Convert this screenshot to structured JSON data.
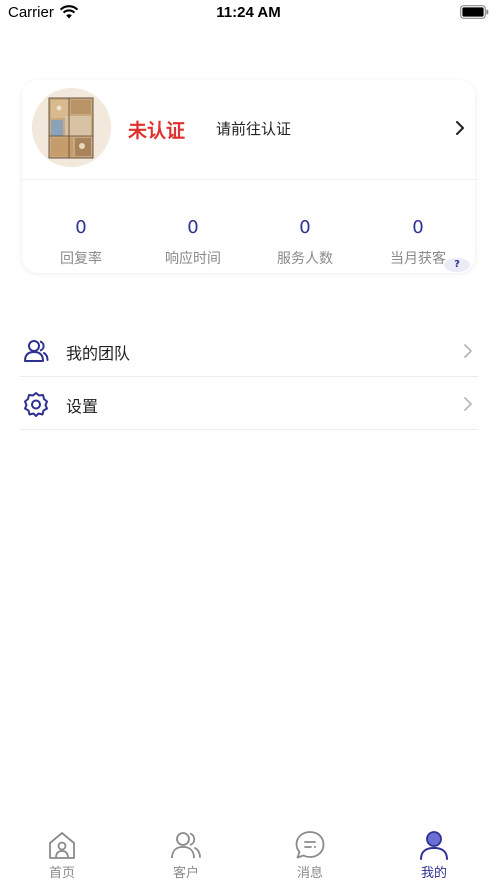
{
  "status_bar": {
    "carrier": "Carrier",
    "time": "11:24 AM"
  },
  "profile": {
    "cert_status": "未认证",
    "cert_prompt": "请前往认证",
    "stats": [
      {
        "value": "0",
        "label": "回复率"
      },
      {
        "value": "0",
        "label": "响应时间"
      },
      {
        "value": "0",
        "label": "服务人数"
      },
      {
        "value": "0",
        "label": "当月获客"
      }
    ],
    "help_symbol": "?"
  },
  "menu": [
    {
      "label": "我的团队",
      "icon": "team-icon"
    },
    {
      "label": "设置",
      "icon": "gear-icon"
    }
  ],
  "tabs": [
    {
      "label": "首页",
      "icon": "home-icon",
      "active": false
    },
    {
      "label": "客户",
      "icon": "customers-icon",
      "active": false
    },
    {
      "label": "消息",
      "icon": "message-icon",
      "active": false
    },
    {
      "label": "我的",
      "icon": "profile-icon",
      "active": true
    }
  ],
  "colors": {
    "accent": "#2e3192",
    "warning_text": "#e02f2f",
    "inactive": "#8a8a8a"
  }
}
